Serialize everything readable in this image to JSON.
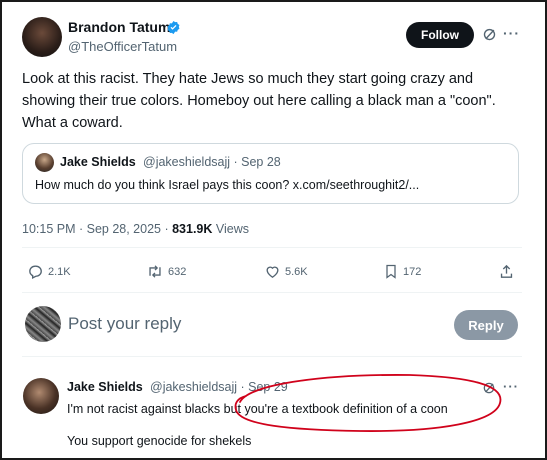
{
  "post": {
    "author_name": "Brandon Tatum",
    "author_handle": "@TheOfficerTatum",
    "follow_label": "Follow",
    "more_label": "···",
    "text": "Look at this racist. They hate Jews so much they start going crazy and showing their true colors. Homeboy out here calling a black man a \"coon\". What a coward.",
    "timestamp": "10:15 PM · Sep 28, 2025 · ",
    "views_count": "831.9K",
    "views_label": " Views"
  },
  "quoted": {
    "author_name": "Jake Shields",
    "author_handle": "@jakeshieldsajj · Sep 28",
    "text": "How much do you think Israel pays this coon? x.com/seethroughit2/..."
  },
  "actions": {
    "replies": "2.1K",
    "reposts": "632",
    "likes": "5.6K",
    "bookmarks": "172"
  },
  "composer": {
    "placeholder": "Post your reply",
    "reply_label": "Reply"
  },
  "reply": {
    "author_name": "Jake Shields",
    "author_handle": "@jakeshieldsajj · Sep 29",
    "more_label": "···",
    "text_part1": "I'm not racist against blacks ",
    "text_part2": "but you're a textbook definition of a coon",
    "text_line2": "You support genocide for shekels"
  },
  "colors": {
    "verified_badge": "#1d9bf0",
    "follow_bg": "#0f1419",
    "reply_btn_bg": "#8b98a5",
    "annotation": "#d0021b",
    "muted": "#536471"
  }
}
